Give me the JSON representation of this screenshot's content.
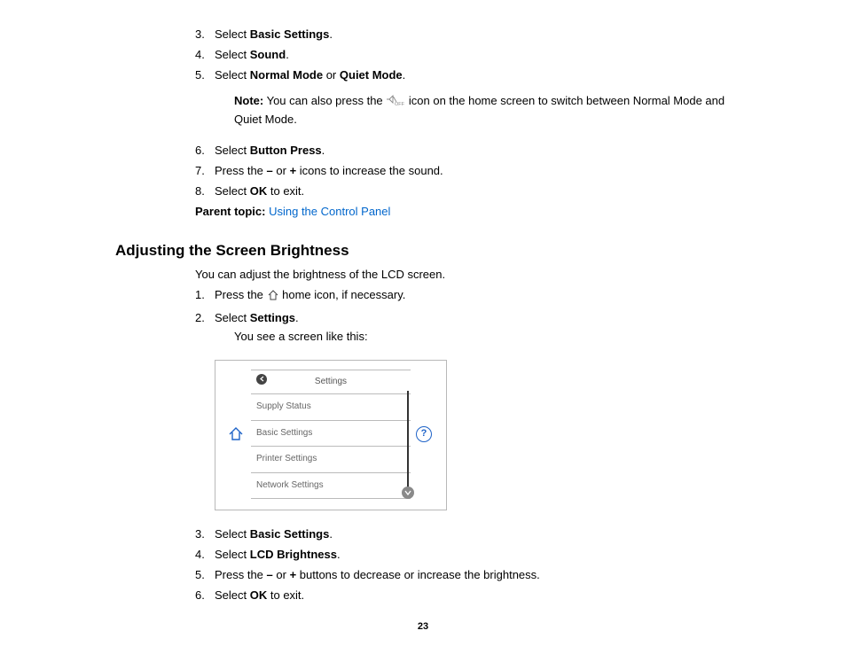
{
  "topSteps": [
    {
      "n": "3.",
      "pre": "Select ",
      "bold": "Basic Settings",
      "post": "."
    },
    {
      "n": "4.",
      "pre": "Select ",
      "bold": "Sound",
      "post": "."
    }
  ],
  "step5": {
    "n": "5.",
    "pre": "Select ",
    "bold1": "Normal Mode",
    "mid": " or ",
    "bold2": "Quiet Mode",
    "post": "."
  },
  "note": {
    "label": "Note:",
    "pre": " You can also press the ",
    "post": " icon on the home screen to switch between Normal Mode and Quiet Mode."
  },
  "afterNoteSteps": {
    "s6": {
      "n": "6.",
      "pre": "Select ",
      "bold": "Button Press",
      "post": "."
    },
    "s7Full": {
      "n": "7.",
      "pre": "Press the ",
      "bold1": "–",
      "mid": " or ",
      "bold2": "+",
      "post": " icons to increase the sound."
    },
    "s8": {
      "n": "8.",
      "pre": "Select ",
      "bold": "OK",
      "post": " to exit."
    }
  },
  "parentTopic": {
    "label": "Parent topic:",
    "link": "Using the Control Panel"
  },
  "sectionTitle": "Adjusting the Screen Brightness",
  "sectionIntro": "You can adjust the brightness of the LCD screen.",
  "brightSteps": {
    "s1": {
      "n": "1.",
      "pre": "Press the ",
      "post": " home icon, if necessary."
    },
    "s2": {
      "n": "2.",
      "pre": "Select ",
      "bold": "Settings",
      "post": ".",
      "sub": "You see a screen like this:"
    }
  },
  "settingsMenu": {
    "title": "Settings",
    "items": [
      "Supply Status",
      "Basic Settings",
      "Printer Settings",
      "Network Settings"
    ]
  },
  "brightSteps2": {
    "s3": {
      "n": "3.",
      "pre": "Select ",
      "bold": "Basic Settings",
      "post": "."
    },
    "s4": {
      "n": "4.",
      "pre": "Select ",
      "bold": "LCD Brightness",
      "post": "."
    },
    "s5": {
      "n": "5.",
      "pre": "Press the ",
      "bold1": "–",
      "mid": " or ",
      "bold2": "+",
      "post": " buttons to decrease or increase the brightness."
    },
    "s6": {
      "n": "6.",
      "pre": "Select ",
      "bold": "OK",
      "post": " to exit."
    }
  },
  "pageNumber": "23"
}
